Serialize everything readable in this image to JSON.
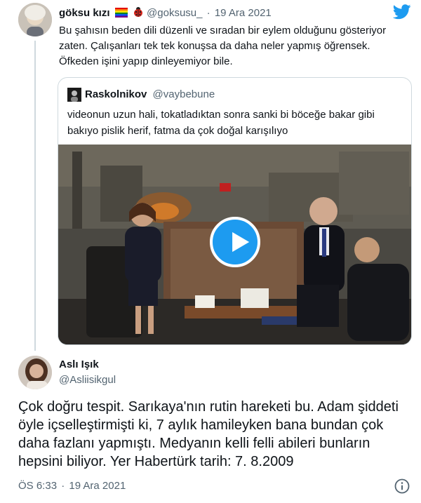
{
  "parent_tweet": {
    "author_name": "göksu kızı",
    "author_emojis": [
      "rainbow-flag-emoji",
      "ladybug-emoji"
    ],
    "handle": "@goksusu_",
    "separator": "·",
    "date": "19 Ara 2021",
    "text": "Bu şahısın beden dili düzenli ve sıradan bir eylem olduğunu gösteriyor zaten. Çalışanları tek tek konuşsa da daha neler yapmış öğrensek. Öfkeden işini yapıp dinleyemiyor bile.",
    "quoted_tweet": {
      "author_name": "Raskolnikov",
      "handle": "@vaybebune",
      "text": "videonun uzun hali, tokatladıktan sonra sanki bi böceğe bakar gibi bakıyo pislik herif, fatma da çok doğal karışılıyo",
      "media": {
        "type": "video",
        "control": "play-icon"
      }
    }
  },
  "main_tweet": {
    "author_name": "Aslı Işık",
    "handle": "@Asliisikgul",
    "text": "Çok doğru tespit. Sarıkaya'nın rutin hareketi bu. Adam şiddeti öyle içselleştirmişti ki, 7 aylık hamileyken bana bundan çok daha fazlanı yapmıştı. Medyanın kelli felli abileri bunların hepsini biliyor.  Yer Habertürk tarih: 7. 8.2009",
    "time": "ÖS 6:33",
    "separator": "·",
    "date": "19 Ara 2021"
  },
  "colors": {
    "twitter_blue": "#1d9bf0",
    "secondary_text": "#536471",
    "border": "#cfd9de"
  }
}
